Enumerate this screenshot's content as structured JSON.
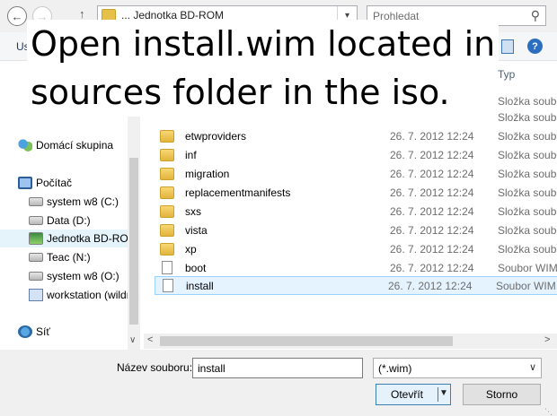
{
  "caption": {
    "line1": "Open install.wim located in",
    "line2": "sources folder in the iso."
  },
  "address": {
    "path": "... Jednotka BD-ROM",
    "search_placeholder": "Prohledat"
  },
  "toolbar": {
    "organize_label": "Us"
  },
  "file_list": {
    "type_header": "Typ",
    "partial_type_rows": [
      "Složka soubo",
      "Složka soubo"
    ],
    "rows": [
      {
        "name": "etwproviders",
        "date": "26. 7. 2012 12:24",
        "type": "Složka soubo",
        "kind": "folder"
      },
      {
        "name": "inf",
        "date": "26. 7. 2012 12:24",
        "type": "Složka soubo",
        "kind": "folder"
      },
      {
        "name": "migration",
        "date": "26. 7. 2012 12:24",
        "type": "Složka soubo",
        "kind": "folder"
      },
      {
        "name": "replacementmanifests",
        "date": "26. 7. 2012 12:24",
        "type": "Složka soubo",
        "kind": "folder"
      },
      {
        "name": "sxs",
        "date": "26. 7. 2012 12:24",
        "type": "Složka soubo",
        "kind": "folder"
      },
      {
        "name": "vista",
        "date": "26. 7. 2012 12:24",
        "type": "Složka soubo",
        "kind": "folder"
      },
      {
        "name": "xp",
        "date": "26. 7. 2012 12:24",
        "type": "Složka soubo",
        "kind": "folder"
      },
      {
        "name": "boot",
        "date": "26. 7. 2012 12:24",
        "type": "Soubor WIM",
        "kind": "file"
      },
      {
        "name": "install",
        "date": "26. 7. 2012 12:24",
        "type": "Soubor WIM",
        "kind": "file",
        "selected": true
      }
    ]
  },
  "nav": {
    "items": [
      {
        "label": "Domácí skupina",
        "icon": "homegroup-icon"
      },
      {
        "label": "Počítač",
        "icon": "computer-icon"
      },
      {
        "label": "system w8 (C:)",
        "icon": "drive-icon"
      },
      {
        "label": "Data (D:)",
        "icon": "drive-icon"
      },
      {
        "label": "Jednotka BD-ROM",
        "icon": "bd-rom-icon",
        "selected": true
      },
      {
        "label": "Teac (N:)",
        "icon": "drive-icon"
      },
      {
        "label": "system w8 (O:)",
        "icon": "drive-icon"
      },
      {
        "label": "workstation (wildr",
        "icon": "network-drive-icon"
      },
      {
        "label": "Síť",
        "icon": "network-icon"
      }
    ]
  },
  "bottom": {
    "filename_label": "Název souboru:",
    "filename_value": "install",
    "filter_value": "(*.wim)",
    "open_label": "Otevřít",
    "cancel_label": "Storno"
  }
}
